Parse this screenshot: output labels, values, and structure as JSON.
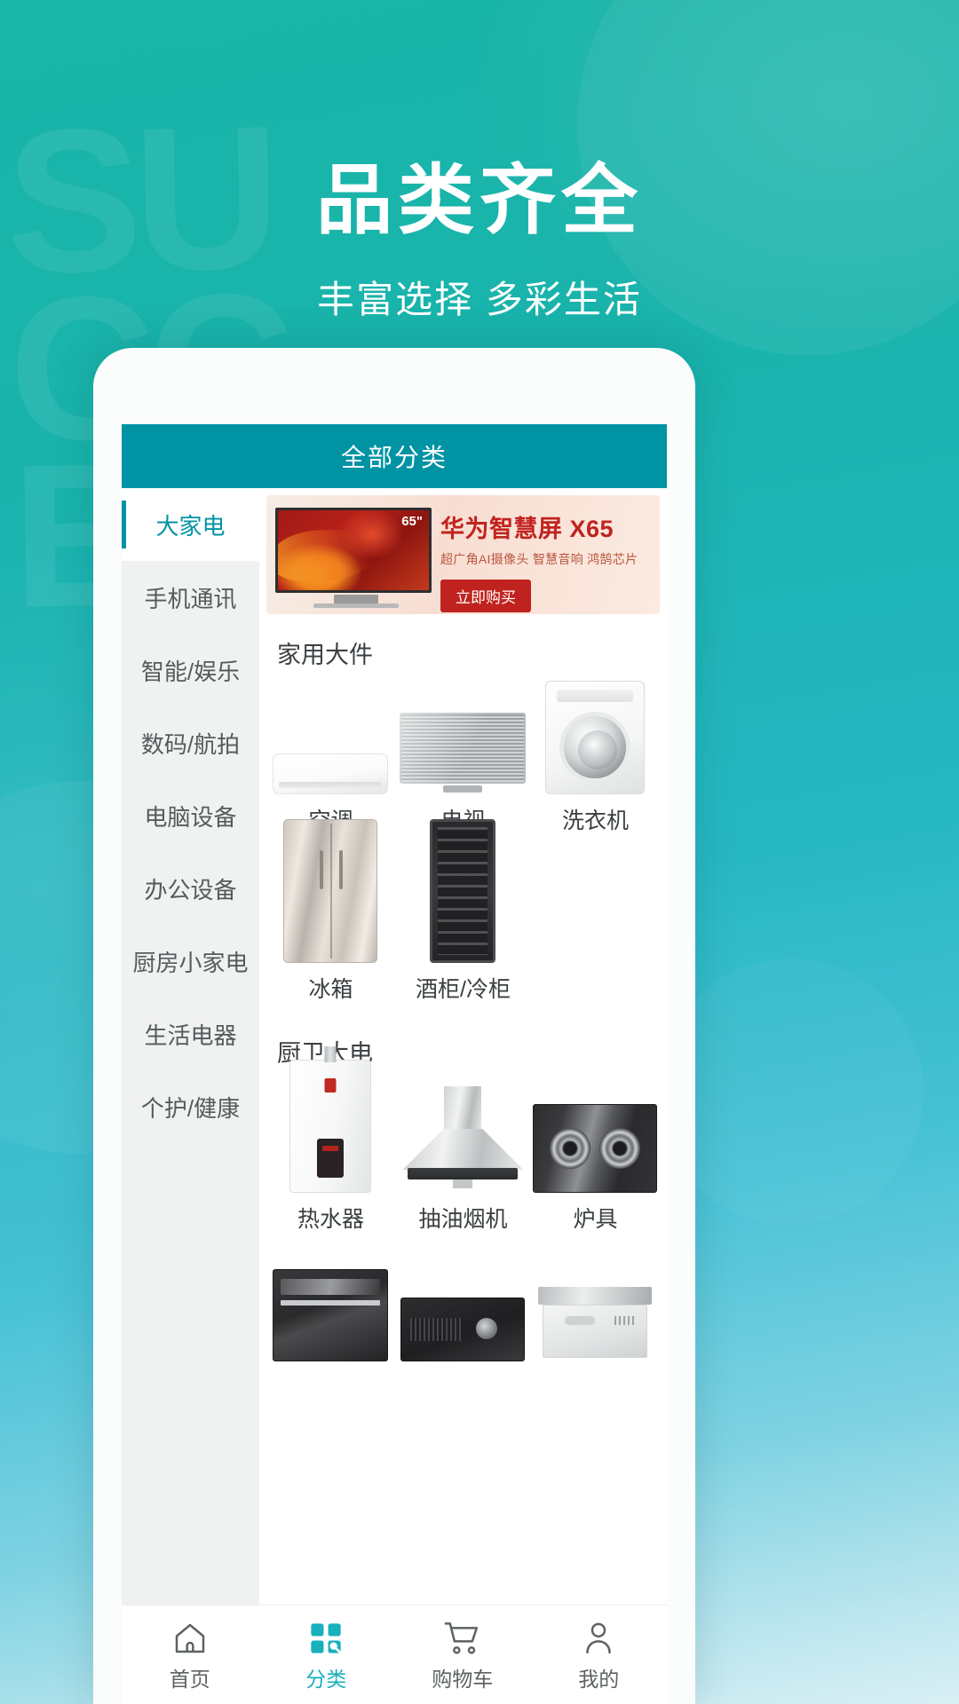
{
  "hero": {
    "title": "品类齐全",
    "subtitle": "丰富选择 多彩生活",
    "bg_letters": "SU\nCC\nESS",
    "bg_color": "#16b0a5"
  },
  "app": {
    "header": {
      "title": "全部分类",
      "bg_color": "#0093a4"
    },
    "accent_color": "#0093a4",
    "sidebar": {
      "items": [
        {
          "label": "大家电",
          "active": true
        },
        {
          "label": "手机通讯",
          "active": false
        },
        {
          "label": "智能/娱乐",
          "active": false
        },
        {
          "label": "数码/航拍",
          "active": false
        },
        {
          "label": "电脑设备",
          "active": false
        },
        {
          "label": "办公设备",
          "active": false
        },
        {
          "label": "厨房小家电",
          "active": false
        },
        {
          "label": "生活电器",
          "active": false
        },
        {
          "label": "个护/健康",
          "active": false
        }
      ]
    },
    "ad": {
      "title": "华为智慧屏 X65",
      "subtitle": "超广角AI摄像头 智慧音响 鸿鹄芯片",
      "button": "立即购买",
      "screen_size": "65\"",
      "accent_color": "#c0231f"
    },
    "sections": [
      {
        "title": "家用大件",
        "items": [
          {
            "label": "空调",
            "art": "ac"
          },
          {
            "label": "电视",
            "art": "tv"
          },
          {
            "label": "洗衣机",
            "art": "washer"
          },
          {
            "label": "冰箱",
            "art": "fridge"
          },
          {
            "label": "酒柜/冷柜",
            "art": "wine"
          }
        ]
      },
      {
        "title": "厨卫大电",
        "items": [
          {
            "label": "热水器",
            "art": "heater"
          },
          {
            "label": "抽油烟机",
            "art": "hood"
          },
          {
            "label": "炉具",
            "art": "stove"
          },
          {
            "label": "",
            "art": "oven"
          },
          {
            "label": "",
            "art": "micro"
          },
          {
            "label": "",
            "art": "dish"
          }
        ]
      }
    ],
    "tabbar": {
      "items": [
        {
          "label": "首页",
          "icon": "home-icon",
          "active": false
        },
        {
          "label": "分类",
          "icon": "grid-icon",
          "active": true
        },
        {
          "label": "购物车",
          "icon": "cart-icon",
          "active": false
        },
        {
          "label": "我的",
          "icon": "person-icon",
          "active": false
        }
      ]
    }
  }
}
